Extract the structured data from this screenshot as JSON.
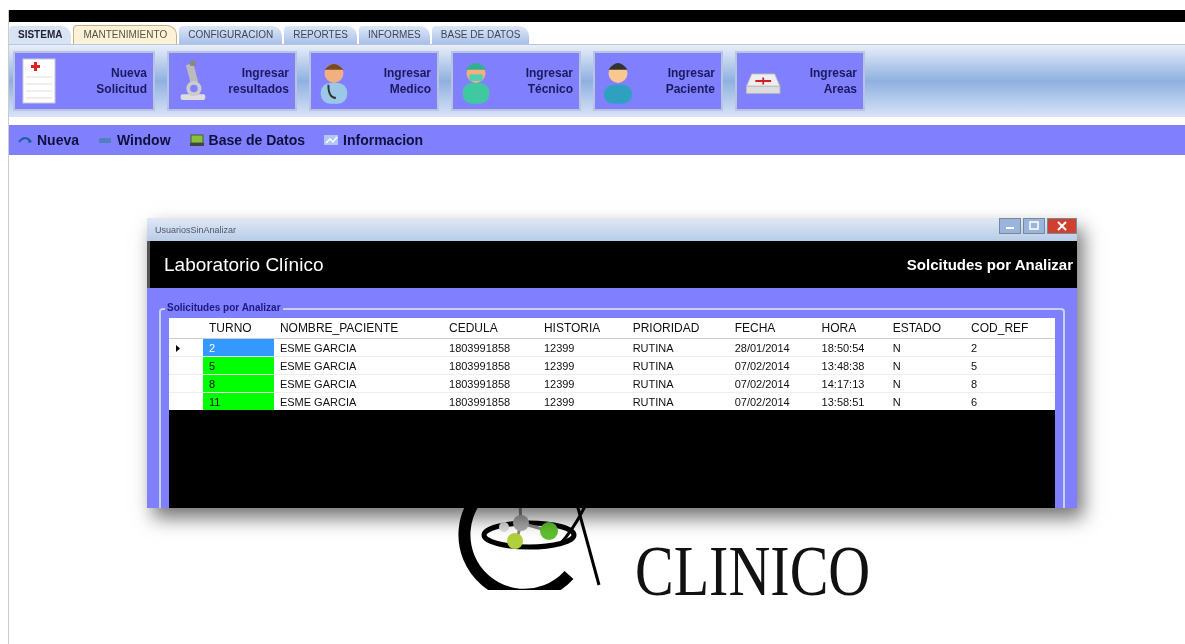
{
  "menu_tabs": [
    {
      "label": "SISTEMA",
      "selected": false
    },
    {
      "label": "MANTENIMIENTO",
      "selected": true
    },
    {
      "label": "CONFIGURACION",
      "selected": false
    },
    {
      "label": "REPORTES",
      "selected": false
    },
    {
      "label": "INFORMES",
      "selected": false
    },
    {
      "label": "BASE DE DATOS",
      "selected": false
    }
  ],
  "ribbon_buttons": [
    {
      "label": "Nueva Solicitud"
    },
    {
      "label": "Ingresar resultados"
    },
    {
      "label": "Ingresar Medico"
    },
    {
      "label": "Ingresar Técnico"
    },
    {
      "label": "Ingresar Paciente"
    },
    {
      "label": "Ingresar Areas"
    }
  ],
  "toolbar": [
    {
      "label": "Nueva"
    },
    {
      "label": "Window"
    },
    {
      "label": "Base de Datos"
    },
    {
      "label": "Informacion"
    }
  ],
  "logo": {
    "line_2": "CLINICO"
  },
  "dialog": {
    "title": "UsuariosSinAnalizar",
    "header_title": "Laboratorio Clínico",
    "header_subtitle": "Solcitudes por Analizar",
    "group_title": "Solicitudes por Analizar",
    "table": {
      "columns": [
        "TURNO",
        "NOMBRE_PACIENTE",
        "CEDULA",
        "HISTORIA",
        "PRIORIDAD",
        "FECHA",
        "HORA",
        "ESTADO",
        "COD_REF"
      ],
      "rows": [
        {
          "selected": true,
          "cells": [
            "2",
            "ESME GARCIA",
            "1803991858",
            "12399",
            "RUTINA",
            "28/01/2014",
            "18:50:54",
            "N",
            "2"
          ]
        },
        {
          "selected": false,
          "color": "#00ff00",
          "cells": [
            "5",
            "ESME GARCIA",
            "1803991858",
            "12399",
            "RUTINA",
            "07/02/2014",
            "13:48:38",
            "N",
            "5"
          ]
        },
        {
          "selected": false,
          "color": "#00ff00",
          "cells": [
            "8",
            "ESME GARCIA",
            "1803991858",
            "12399",
            "RUTINA",
            "07/02/2014",
            "14:17:13",
            "N",
            "8"
          ]
        },
        {
          "selected": false,
          "color": "#00ff00",
          "cells": [
            "11",
            "ESME GARCIA",
            "1803991858",
            "12399",
            "RUTINA",
            "07/02/2014",
            "13:58:51",
            "N",
            "6"
          ]
        }
      ]
    }
  }
}
